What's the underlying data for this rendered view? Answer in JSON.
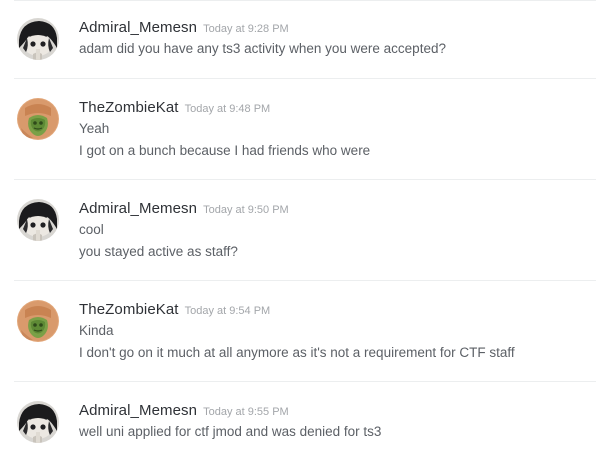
{
  "messages": [
    {
      "user": "Admiral_Memesn",
      "time": "Today at 9:28 PM",
      "avatar": "dark-haired-character-avatar",
      "lines": [
        "adam did you have any ts3 activity when you were accepted?"
      ]
    },
    {
      "user": "TheZombieKat",
      "time": "Today at 9:48 PM",
      "avatar": "zombie-cat-avatar",
      "lines": [
        "Yeah",
        "I got on a bunch because I had friends who were"
      ]
    },
    {
      "user": "Admiral_Memesn",
      "time": "Today at 9:50 PM",
      "avatar": "dark-haired-character-avatar",
      "lines": [
        "cool",
        "you stayed active as staff?"
      ]
    },
    {
      "user": "TheZombieKat",
      "time": "Today at 9:54 PM",
      "avatar": "zombie-cat-avatar",
      "lines": [
        "Kinda",
        "I don't go on it much at all anymore as it's not a requirement for CTF staff"
      ]
    },
    {
      "user": "Admiral_Memesn",
      "time": "Today at 9:55 PM",
      "avatar": "dark-haired-character-avatar",
      "lines": [
        "well uni applied for ctf jmod and was denied for ts3"
      ]
    }
  ]
}
